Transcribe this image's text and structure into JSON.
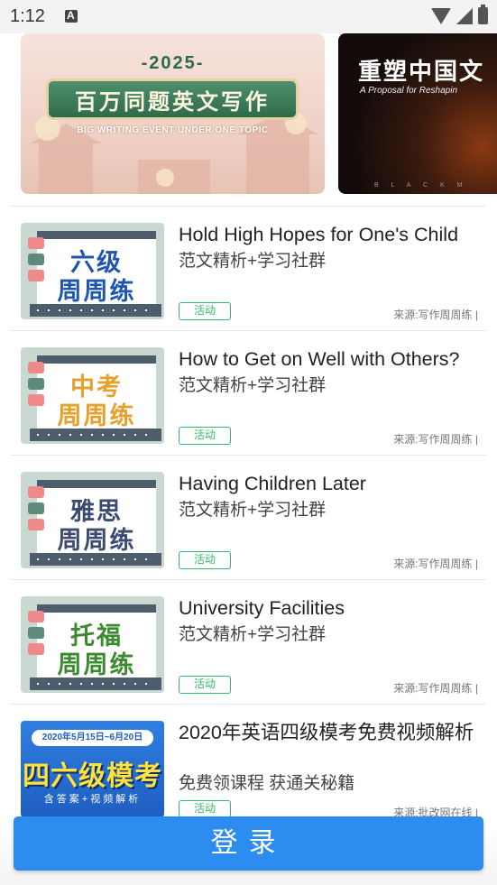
{
  "status_bar": {
    "time": "1:12"
  },
  "banners": [
    {
      "year": "-2025-",
      "title": "百万同题英文写作",
      "subtitle": "BIG WRITING EVENT UNDER ONE TOPIC"
    },
    {
      "title": "重塑中国文",
      "subtitle": "A Proposal for Reshapin",
      "footer": "B L A C K M"
    }
  ],
  "items": [
    {
      "thumb_line1": "六级",
      "thumb_line2": "周周练",
      "thumb_color": "#1f55b0",
      "title": "Hold High Hopes for One's Child",
      "subtitle": "范文精析+学习社群",
      "tag": "活动",
      "source": "来源:写作周周练 |"
    },
    {
      "thumb_line1": "中考",
      "thumb_line2": "周周练",
      "thumb_color": "#e5a12b",
      "title": "How to Get on Well with Others?",
      "subtitle": "范文精析+学习社群",
      "tag": "活动",
      "source": "来源:写作周周练 |"
    },
    {
      "thumb_line1": "雅思",
      "thumb_line2": "周周练",
      "thumb_color": "#3d4a72",
      "title": "Having Children Later",
      "subtitle": "范文精析+学习社群",
      "tag": "活动",
      "source": "来源:写作周周练 |"
    },
    {
      "thumb_line1": "托福",
      "thumb_line2": "周周练",
      "thumb_color": "#3b8a2f",
      "title": "University Facilities",
      "subtitle": "范文精析+学习社群",
      "tag": "活动",
      "source": "来源:写作周周练 |"
    },
    {
      "thumb_date": "2020年5月15日~6月20日",
      "thumb_big": "四六级模考",
      "thumb_small": "含答案+视频解析",
      "title": "2020年英语四级模考免费视频解析",
      "subtitle": "免费领课程 获通关秘籍",
      "tag": "活动",
      "source": "来源:批改网在线 |"
    }
  ],
  "login_button": "登录"
}
